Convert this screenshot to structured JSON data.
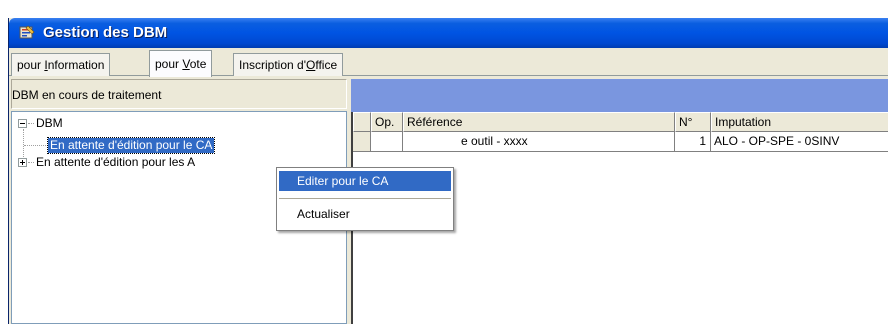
{
  "window": {
    "title": "Gestion des DBM",
    "icon": "app-form-icon"
  },
  "tabs": [
    {
      "label_pre": "pour ",
      "label_key": "I",
      "label_post": "nformation",
      "active": false
    },
    {
      "label_pre": "pour ",
      "label_key": "V",
      "label_post": "ote",
      "active": true
    },
    {
      "label_pre": "Inscription d'",
      "label_key": "O",
      "label_post": "ffice",
      "active": false
    }
  ],
  "left_panel": {
    "header": "DBM en cours de traitement",
    "tree": {
      "root": "DBM",
      "children": [
        {
          "label": "En attente d'édition pour le CA",
          "selected": true
        },
        {
          "label": "En attente d'édition pour les A",
          "selected": false
        }
      ]
    }
  },
  "grid": {
    "columns": [
      "",
      "Op.",
      "Référence",
      "N°",
      "Imputation"
    ],
    "rows": [
      {
        "op": "",
        "reference": "e outil - xxxx",
        "numero": "1",
        "imputation": "ALO - OP-SPE - 0SINV"
      }
    ]
  },
  "context_menu": {
    "items": [
      "Editer pour le CA",
      "Actualiser"
    ]
  },
  "colors": {
    "titlebar": "#0054e3",
    "selection": "#316ac5",
    "right_header": "#7a96df",
    "window_bg": "#ece9d8"
  }
}
